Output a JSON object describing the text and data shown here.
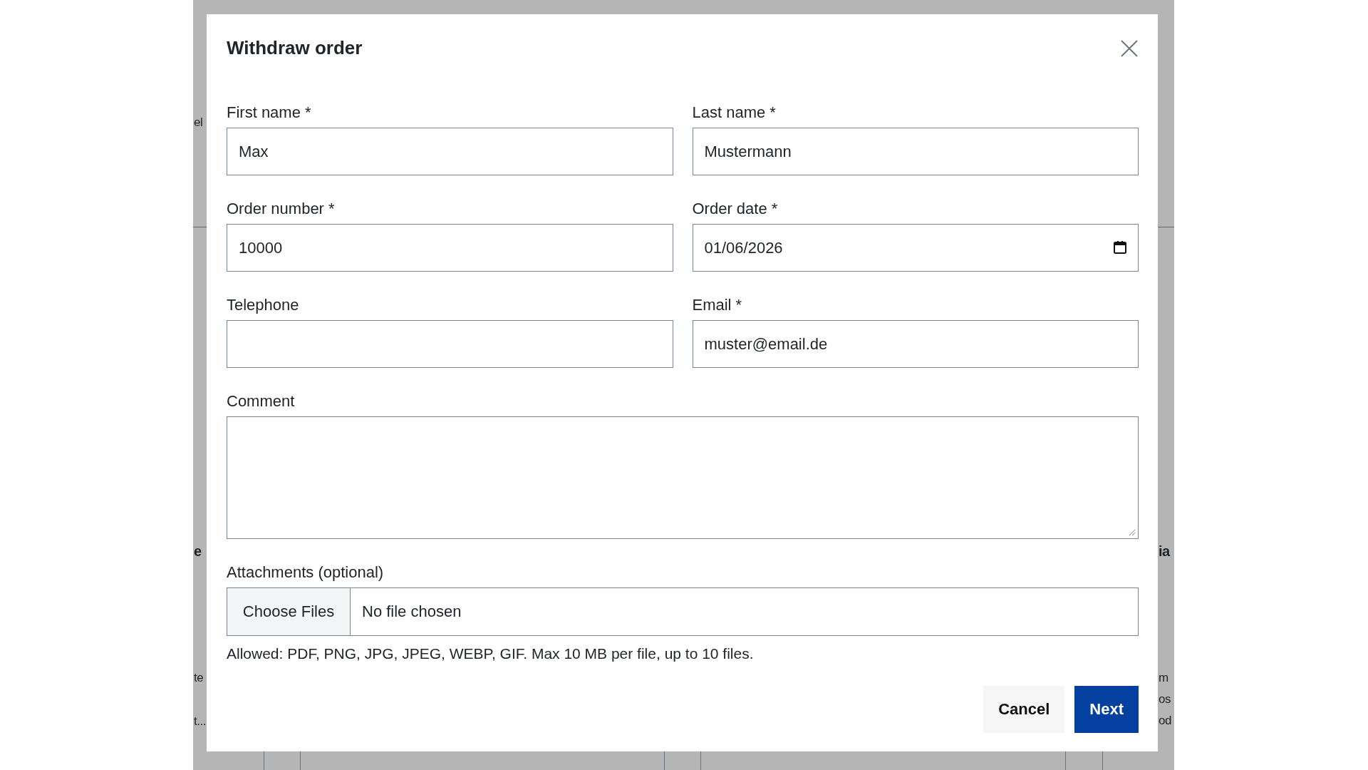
{
  "background_page": {
    "left_fragments": [
      {
        "text": "el",
        "kind": "plain"
      },
      {
        "text": "e",
        "kind": "heading"
      },
      {
        "text": "te",
        "kind": "plain"
      },
      {
        "text": "t...",
        "kind": "plain"
      }
    ],
    "right_fragments": [
      {
        "text": "ia",
        "kind": "heading"
      },
      {
        "text": "m",
        "kind": "plain"
      },
      {
        "text": "os",
        "kind": "plain"
      },
      {
        "text": "od",
        "kind": "plain"
      }
    ]
  },
  "dialog": {
    "title": "Withdraw order",
    "fields": [
      {
        "label": "First name *",
        "value": "Max",
        "kind": "text"
      },
      {
        "label": "Last name *",
        "value": "Mustermann",
        "kind": "text"
      },
      {
        "label": "Order number *",
        "value": "10000",
        "kind": "text"
      },
      {
        "label": "Order date *",
        "value": "01/06/2026",
        "kind": "date"
      },
      {
        "label": "Telephone",
        "kind": "text"
      },
      {
        "label": "Email *",
        "value": "muster@email.de",
        "kind": "text"
      }
    ],
    "comment": {
      "label": "Comment"
    },
    "attachments": {
      "label": "Attachments (optional)",
      "button": "Choose Files",
      "status": "No file chosen",
      "hint": "Allowed: PDF, PNG, JPG, JPEG, WEBP, GIF. Max 10 MB per file, up to 10 files."
    },
    "buttons": [
      {
        "label": "Cancel",
        "kind": "secondary"
      },
      {
        "label": "Next",
        "kind": "primary"
      }
    ]
  }
}
